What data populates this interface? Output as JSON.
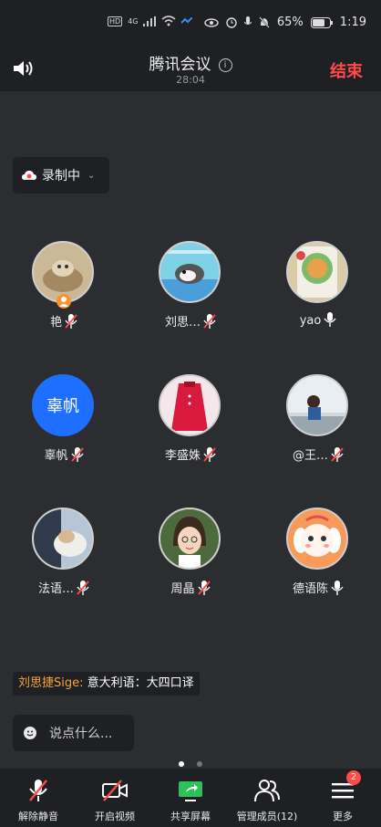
{
  "status_bar": {
    "left": [
      "HD",
      "4G",
      "signal",
      "wifi"
    ],
    "battery": "65%",
    "time": "1:19"
  },
  "header": {
    "title": "腾讯会议",
    "timer": "28:04",
    "end_label": "结束"
  },
  "recording": {
    "label": "录制中"
  },
  "participants": [
    {
      "name": "艳",
      "mic": "muted",
      "host": true
    },
    {
      "name": "刘思…",
      "mic": "muted"
    },
    {
      "name": "yao",
      "mic": "on"
    },
    {
      "name": "辜帆",
      "mic": "muted",
      "avatar_text": "辜帆",
      "avatar_color": "#1e6fff"
    },
    {
      "name": "李盛姝",
      "mic": "muted"
    },
    {
      "name": "@王…",
      "mic": "muted"
    },
    {
      "name": "法语…",
      "mic": "muted"
    },
    {
      "name": "周晶",
      "mic": "muted"
    },
    {
      "name": "德语陈",
      "mic": "on"
    }
  ],
  "chat": {
    "sender": "刘思捷Sige:",
    "message": "意大利语：大四口译"
  },
  "input": {
    "placeholder": "说点什么..."
  },
  "tabs": [
    {
      "label": "解除静音",
      "icon": "mic-muted-icon"
    },
    {
      "label": "开启视频",
      "icon": "video-off-icon"
    },
    {
      "label": "共享屏幕",
      "icon": "share-screen-icon"
    },
    {
      "label": "管理成员(12)",
      "icon": "members-icon"
    },
    {
      "label": "更多",
      "icon": "more-icon"
    }
  ],
  "more_badge": "2",
  "colors": {
    "accent_red": "#ff4a4a",
    "chat_sender": "#f6a23b",
    "share_green": "#2fbf5b"
  }
}
